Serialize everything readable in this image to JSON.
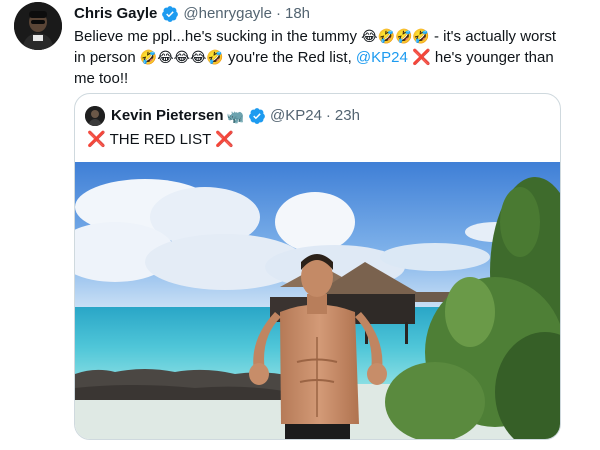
{
  "tweet": {
    "author_name": "Chris Gayle",
    "author_handle": "@henrygayle",
    "separator": "·",
    "time": "18h",
    "text_line1_a": "Believe me ppl...he's sucking in the tummy ",
    "emojis_1": "😂🤣🤣🤣",
    "text_line1_b": " - it's actually worst",
    "text_line2_a": "in person ",
    "emojis_2": "🤣😂😂😂🤣",
    "text_line2_b": " you're the Red list, ",
    "mention": "@KP24",
    "cross_1": "❌",
    "text_line2_c": " he's younger than",
    "text_line3": "me too!!"
  },
  "quoted": {
    "author_name": "Kevin Pietersen",
    "rhino_emoji": "🦏",
    "author_handle": "@KP24",
    "separator": "·",
    "time": "23h",
    "cross_left": "❌",
    "text": " THE RED LIST ",
    "cross_right": "❌"
  },
  "icons": {
    "verified": "verified-badge-icon"
  },
  "colors": {
    "accent": "#1d9bf0",
    "text": "#0f1419",
    "muted": "#536471",
    "border": "#cfd9de",
    "cross": "#e0244c"
  }
}
